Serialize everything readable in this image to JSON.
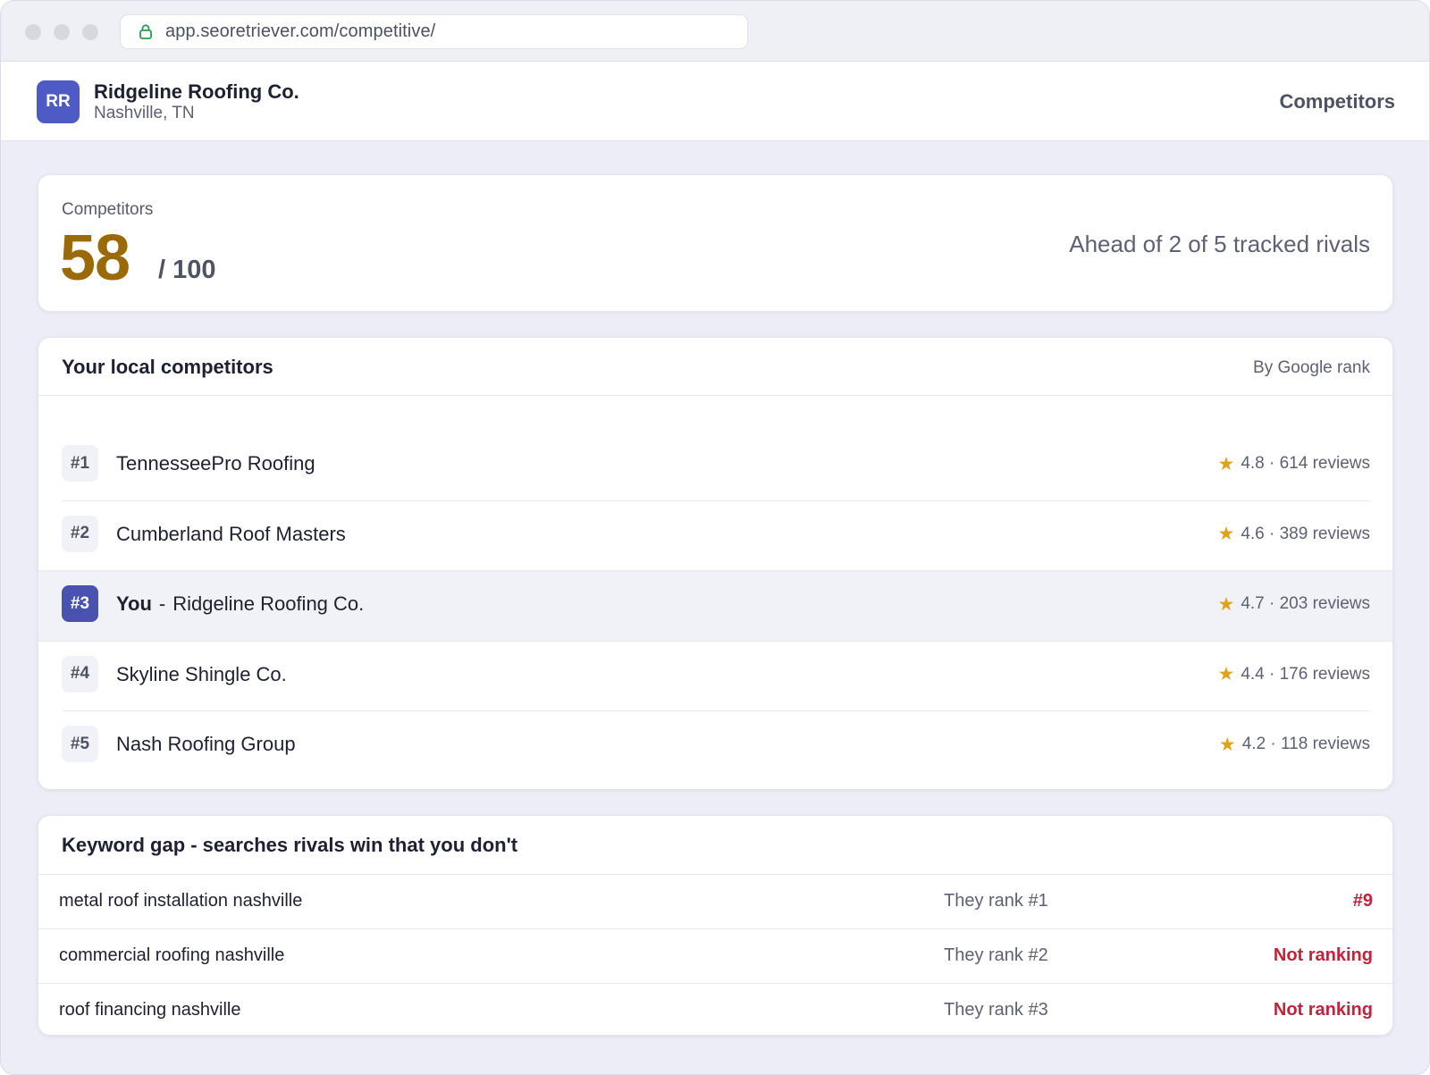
{
  "browser": {
    "url": "app.seoretriever.com/competitive/"
  },
  "header": {
    "avatar_initials": "RR",
    "business_name": "Ridgeline Roofing Co.",
    "location": "Nashville, TN",
    "nav_label": "Competitors"
  },
  "score": {
    "label": "Competitors",
    "value": "58",
    "max": "/ 100",
    "summary": "Ahead of 2 of 5 tracked rivals",
    "value_color": "#9a6a07"
  },
  "competitors": {
    "title": "Your local competitors",
    "sort_label": "By Google rank",
    "rows": [
      {
        "rank": "#1",
        "name": "TennesseePro Roofing",
        "rating": "4.8 · 614 reviews"
      },
      {
        "rank": "#2",
        "name": "Cumberland Roof Masters",
        "rating": "4.6 · 389 reviews"
      },
      {
        "rank": "#3",
        "you_label": "You",
        "dash": "-",
        "name": "Ridgeline Roofing Co.",
        "rating": "4.7 · 203 reviews"
      },
      {
        "rank": "#4",
        "name": "Skyline Shingle Co.",
        "rating": "4.4 · 176 reviews"
      },
      {
        "rank": "#5",
        "name": "Nash Roofing Group",
        "rating": "4.2 · 118 reviews"
      }
    ],
    "star_icon": "star-icon",
    "star_color": "#e0a21b"
  },
  "keyword_gap": {
    "title": "Keyword gap  -  searches rivals win that you don't",
    "rows": [
      {
        "term": "metal roof installation nashville",
        "they": "They rank #1",
        "you": "#9"
      },
      {
        "term": "commercial roofing nashville",
        "they": "They rank #2",
        "you": "Not ranking"
      },
      {
        "term": "roof financing nashville",
        "they": "They rank #3",
        "you": "Not ranking"
      }
    ],
    "alert_color": "#c0243c"
  }
}
